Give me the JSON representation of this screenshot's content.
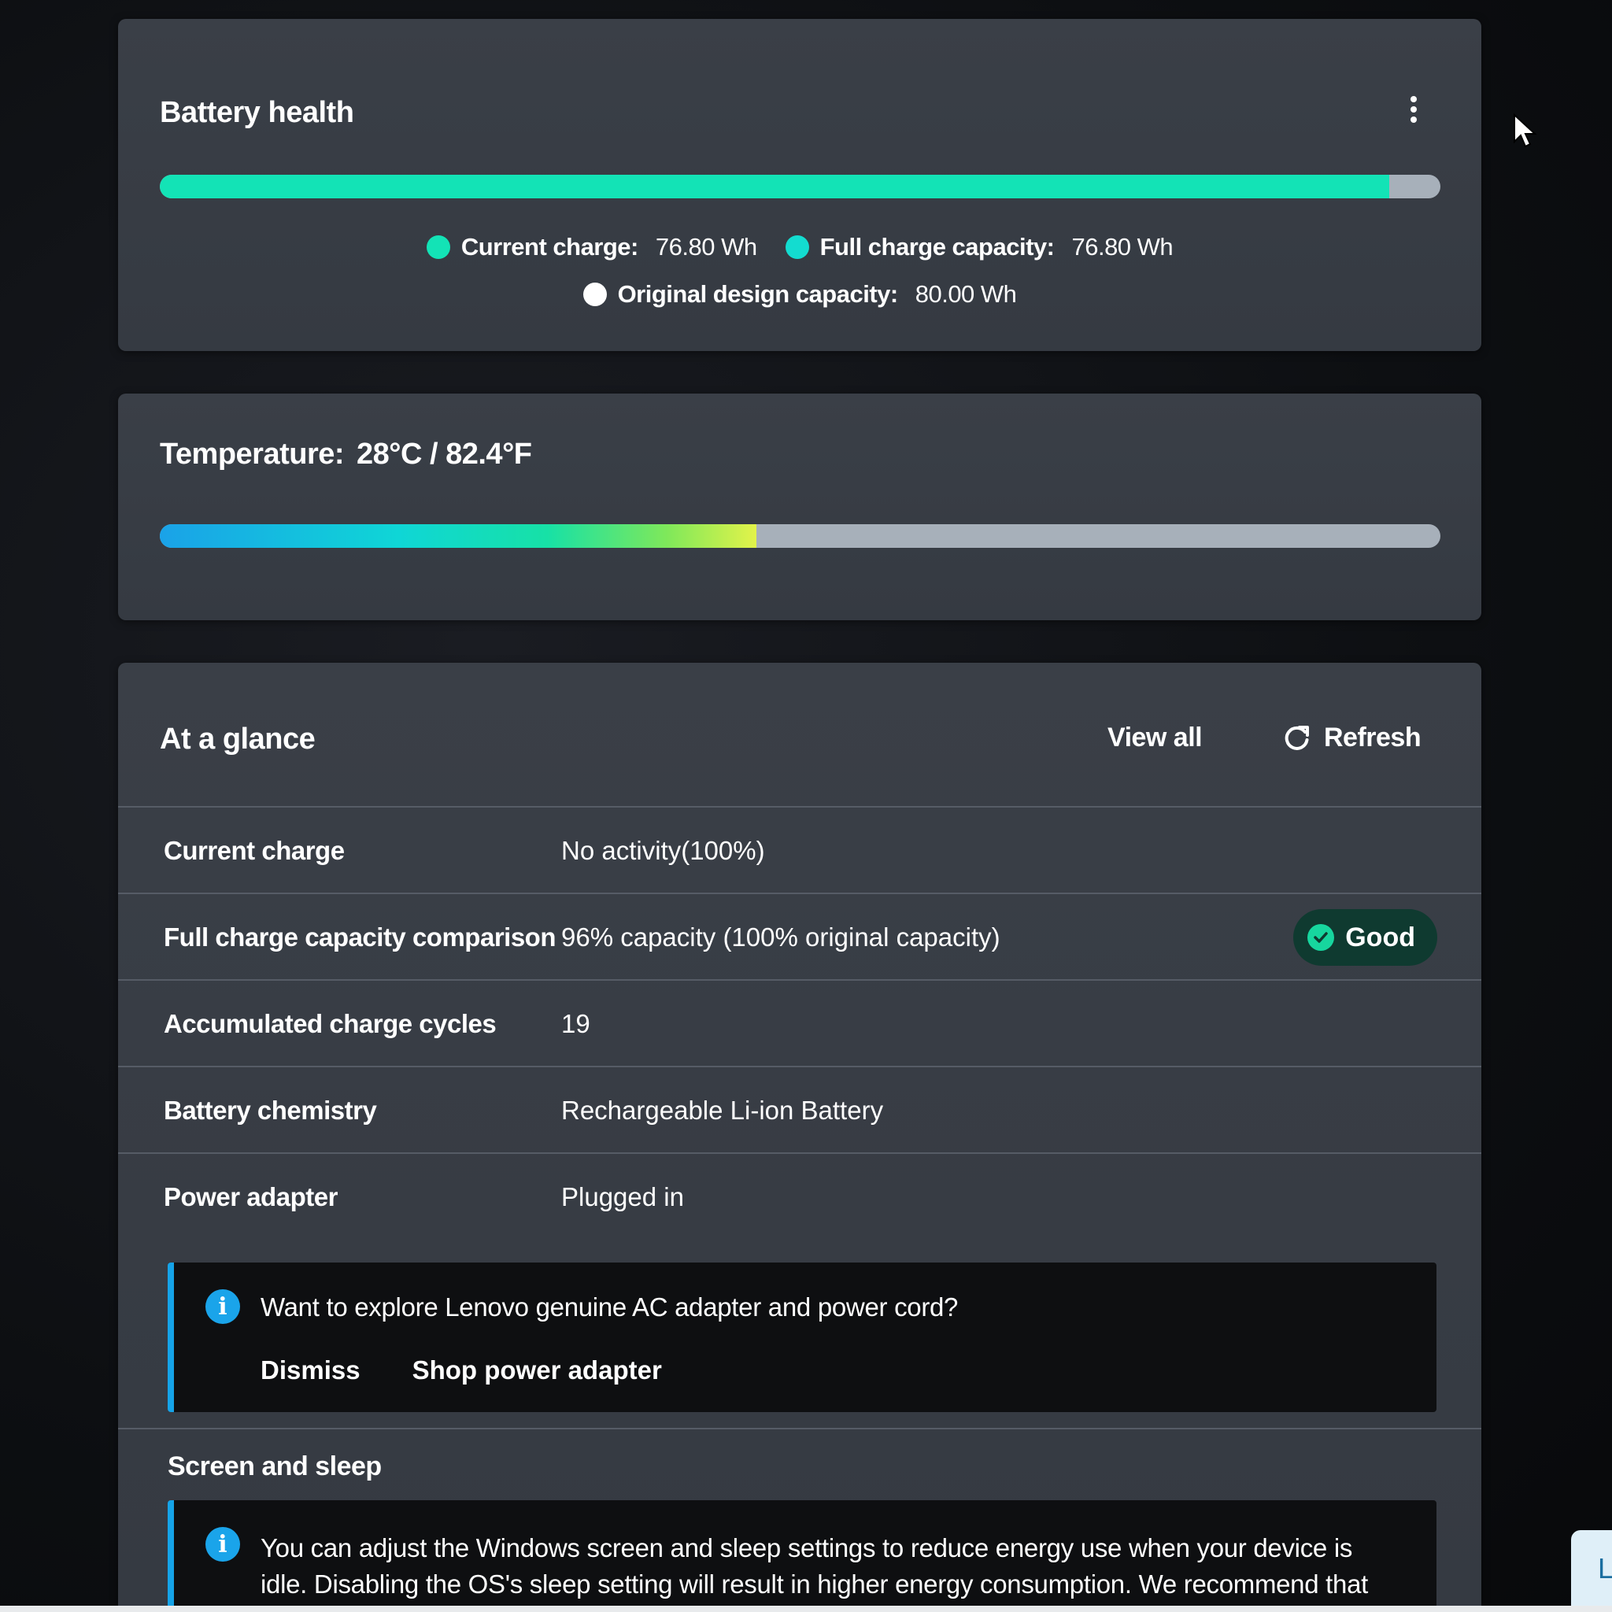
{
  "battery_health": {
    "title": "Battery health",
    "more_icon": "more-vertical-icon",
    "bar_fill_fraction": 0.96,
    "legend": {
      "current_charge_label": "Current charge:",
      "current_charge_value": "76.80 Wh",
      "full_capacity_label": "Full charge capacity:",
      "full_capacity_value": "76.80 Wh",
      "design_capacity_label": "Original design capacity:",
      "design_capacity_value": "80.00 Wh"
    },
    "colors": {
      "current_charge": "#13e3b6",
      "full_capacity": "#13dcd0",
      "design_capacity": "#ffffff",
      "track": "#a7b0ba"
    }
  },
  "temperature": {
    "label": "Temperature:",
    "value": "28°C / 82.4°F",
    "bar_fill_fraction": 0.466
  },
  "at_a_glance": {
    "title": "At a glance",
    "view_all": "View all",
    "refresh": "Refresh",
    "refresh_icon": "refresh-icon",
    "rows": [
      {
        "label": "Current charge",
        "value": "No activity(100%)"
      },
      {
        "label": "Full charge capacity comparison",
        "value": "96% capacity (100% original capacity)",
        "badge": "Good",
        "badge_icon": "check-circle-icon"
      },
      {
        "label": "Accumulated charge cycles",
        "value": "19"
      },
      {
        "label": "Battery chemistry",
        "value": "Rechargeable Li-ion Battery"
      },
      {
        "label": "Power adapter",
        "value": "Plugged in"
      }
    ],
    "adapter_notice": {
      "icon": "info-icon",
      "text": "Want to explore Lenovo genuine AC adapter and power cord?",
      "dismiss": "Dismiss",
      "shop": "Shop power adapter"
    },
    "screen_sleep": {
      "heading": "Screen and sleep",
      "icon": "info-icon",
      "text": "You can adjust the Windows screen and sleep settings to reduce energy use when your device is idle. Disabling the OS's sleep setting will result in higher energy consumption. We recommend that"
    }
  },
  "corner_chip": "L"
}
